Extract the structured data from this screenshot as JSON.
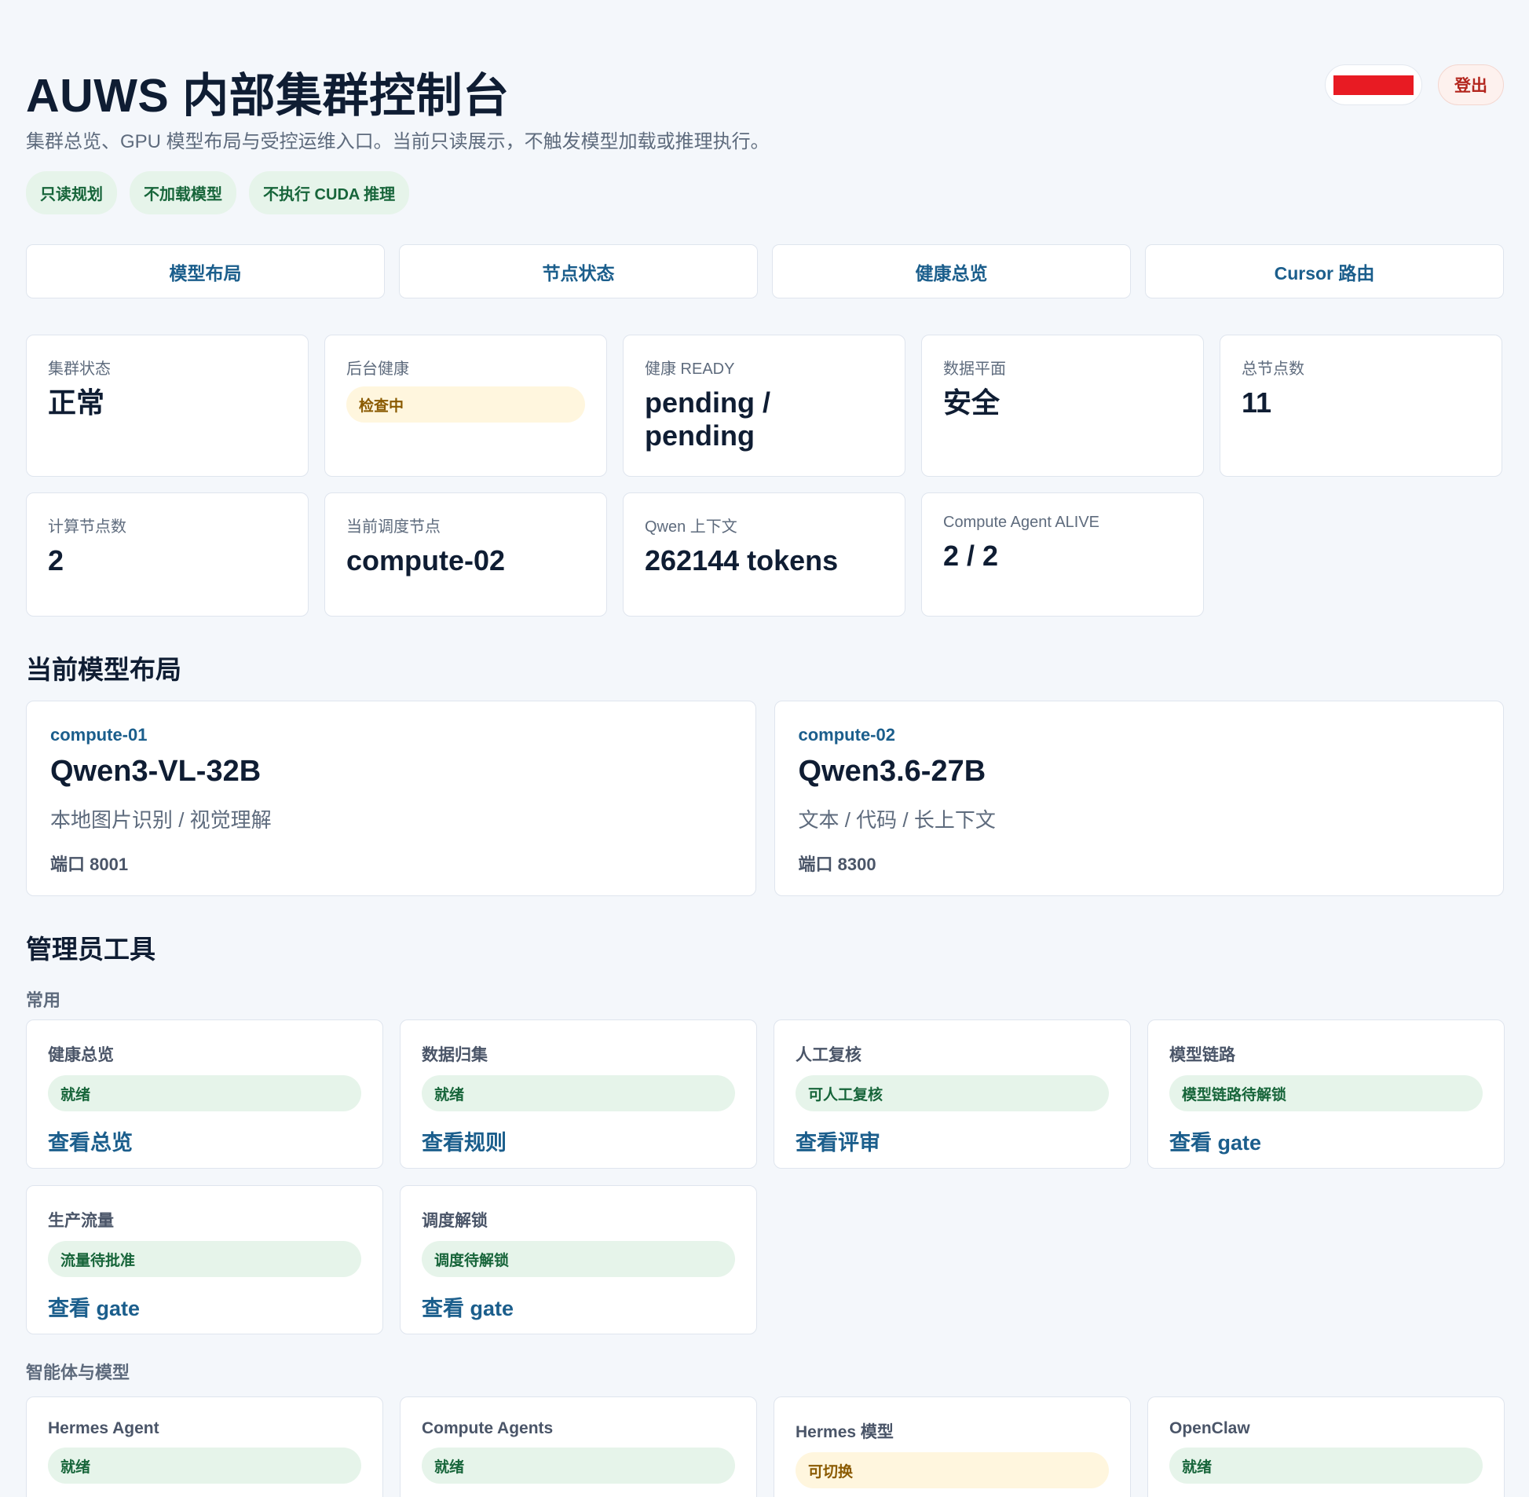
{
  "header": {
    "title": "AUWS 内部集群控制台",
    "subtitle": "集群总览、GPU 模型布局与受控运维入口。当前只读展示，不触发模型加载或推理执行。",
    "chips": [
      "只读规划",
      "不加载模型",
      "不执行 CUDA 推理"
    ],
    "logout_label": "登出"
  },
  "nav": [
    "模型布局",
    "节点状态",
    "健康总览",
    "Cursor 路由"
  ],
  "stats": {
    "cluster_status": {
      "label": "集群状态",
      "value": "正常"
    },
    "backend_health": {
      "label": "后台健康",
      "badge": "检查中"
    },
    "health_ready": {
      "label": "健康 READY",
      "value": "pending / pending"
    },
    "data_plane": {
      "label": "数据平面",
      "value": "安全"
    },
    "total_nodes": {
      "label": "总节点数",
      "value": "11"
    },
    "compute_nodes": {
      "label": "计算节点数",
      "value": "2"
    },
    "current_node": {
      "label": "当前调度节点",
      "value": "compute-02"
    },
    "qwen_context": {
      "label": "Qwen 上下文",
      "value": "262144 tokens"
    },
    "agent_alive": {
      "label": "Compute Agent ALIVE",
      "value": "2 / 2"
    }
  },
  "models_section": {
    "title": "当前模型布局",
    "items": [
      {
        "node": "compute-01",
        "name": "Qwen3-VL-32B",
        "desc": "本地图片识别 / 视觉理解",
        "port": "端口 8001"
      },
      {
        "node": "compute-02",
        "name": "Qwen3.6-27B",
        "desc": "文本 / 代码 / 长上下文",
        "port": "端口 8300"
      }
    ]
  },
  "admin": {
    "title": "管理员工具",
    "common_label": "常用",
    "common": [
      {
        "name": "健康总览",
        "badge": "就绪",
        "link": "查看总览"
      },
      {
        "name": "数据归集",
        "badge": "就绪",
        "link": "查看规则"
      },
      {
        "name": "人工复核",
        "badge": "可人工复核",
        "link": "查看评审"
      },
      {
        "name": "模型链路",
        "badge": "模型链路待解锁",
        "link": "查看 gate"
      },
      {
        "name": "生产流量",
        "badge": "流量待批准",
        "link": "查看 gate"
      },
      {
        "name": "调度解锁",
        "badge": "调度待解锁",
        "link": "查看 gate"
      }
    ],
    "agents_label": "智能体与模型",
    "agents": [
      {
        "name": "Hermes Agent",
        "badge": "就绪"
      },
      {
        "name": "Compute Agents",
        "badge": "就绪"
      },
      {
        "name": "Hermes 模型",
        "badge": "可切换"
      },
      {
        "name": "OpenClaw",
        "badge": "就绪"
      }
    ]
  }
}
